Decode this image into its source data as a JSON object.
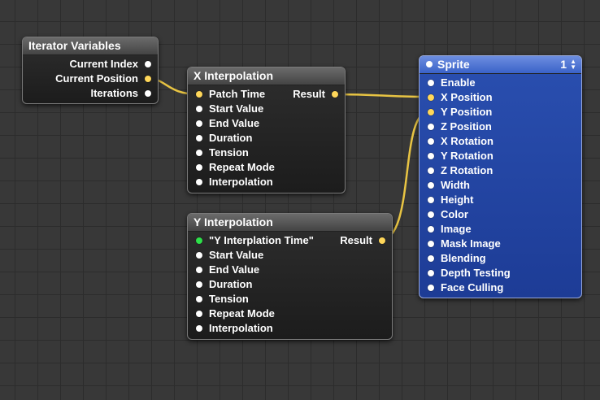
{
  "iterator": {
    "title": "Iterator Variables",
    "outputs": [
      "Current Index",
      "Current Position",
      "Iterations"
    ]
  },
  "x_interp": {
    "title": "X Interpolation",
    "inputs": [
      "Patch Time",
      "Start Value",
      "End Value",
      "Duration",
      "Tension",
      "Repeat Mode",
      "Interpolation"
    ],
    "output": "Result"
  },
  "y_interp": {
    "title": "Y Interpolation",
    "inputs": [
      "\"Y Interplation Time\"",
      "Start Value",
      "End Value",
      "Duration",
      "Tension",
      "Repeat Mode",
      "Interpolation"
    ],
    "output": "Result"
  },
  "sprite": {
    "title": "Sprite",
    "layer": "1",
    "inputs": [
      "Enable",
      "X Position",
      "Y Position",
      "Z Position",
      "X Rotation",
      "Y Rotation",
      "Z Rotation",
      "Width",
      "Height",
      "Color",
      "Image",
      "Mask Image",
      "Blending",
      "Depth Testing",
      "Face Culling"
    ]
  },
  "colors": {
    "background": "#383838",
    "connected_port": "#ffd75a",
    "published_port": "#2ee04a",
    "wire": "#e8c443",
    "sprite_body": "#1d3c96"
  }
}
